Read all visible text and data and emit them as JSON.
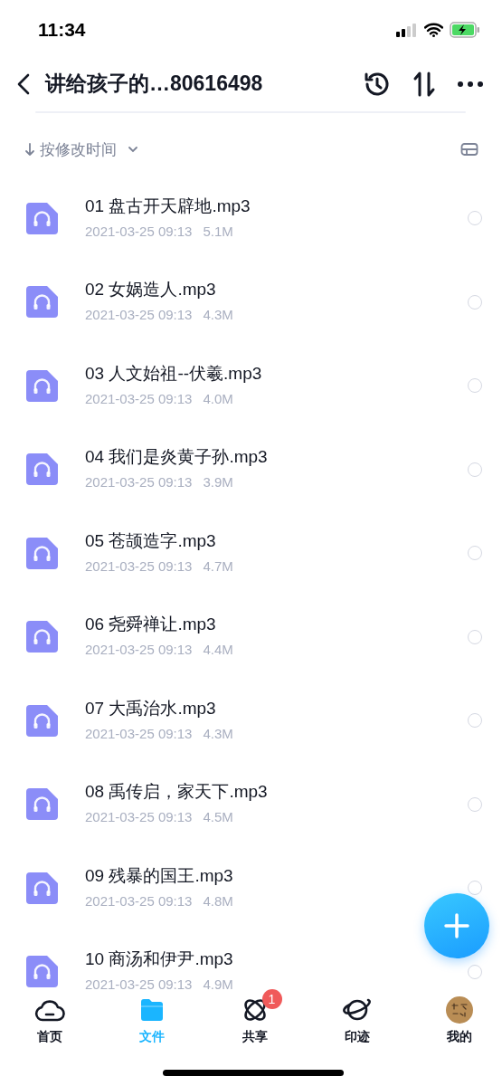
{
  "status_bar": {
    "time": "11:34"
  },
  "header": {
    "title": "讲给孩子的…80616498"
  },
  "sort": {
    "label": "按修改时间"
  },
  "files": [
    {
      "name": "01 盘古开天辟地.mp3",
      "date": "2021-03-25 09:13",
      "size": "5.1M",
      "checked": false
    },
    {
      "name": "02 女娲造人.mp3",
      "date": "2021-03-25 09:13",
      "size": "4.3M",
      "checked": false
    },
    {
      "name": "03 人文始祖--伏羲.mp3",
      "date": "2021-03-25 09:13",
      "size": "4.0M",
      "checked": false
    },
    {
      "name": "04 我们是炎黄子孙.mp3",
      "date": "2021-03-25 09:13",
      "size": "3.9M",
      "checked": false
    },
    {
      "name": "05 苍颉造字.mp3",
      "date": "2021-03-25 09:13",
      "size": "4.7M",
      "checked": false
    },
    {
      "name": "06 尧舜禅让.mp3",
      "date": "2021-03-25 09:13",
      "size": "4.4M",
      "checked": false
    },
    {
      "name": "07 大禹治水.mp3",
      "date": "2021-03-25 09:13",
      "size": "4.3M",
      "checked": false
    },
    {
      "name": "08 禹传启，家天下.mp3",
      "date": "2021-03-25 09:13",
      "size": "4.5M",
      "checked": false
    },
    {
      "name": "09 残暴的国王.mp3",
      "date": "2021-03-25 09:13",
      "size": "4.8M",
      "checked": false
    },
    {
      "name": "10 商汤和伊尹.mp3",
      "date": "2021-03-25 09:13",
      "size": "4.9M",
      "checked": false
    }
  ],
  "tabs": [
    {
      "kind": "home",
      "label": "首页",
      "selected": false
    },
    {
      "kind": "files",
      "label": "文件",
      "selected": true
    },
    {
      "kind": "share",
      "label": "共享",
      "selected": false,
      "badge": "1"
    },
    {
      "kind": "trace",
      "label": "印迹",
      "selected": false
    },
    {
      "kind": "mine",
      "label": "我的",
      "selected": false
    }
  ]
}
